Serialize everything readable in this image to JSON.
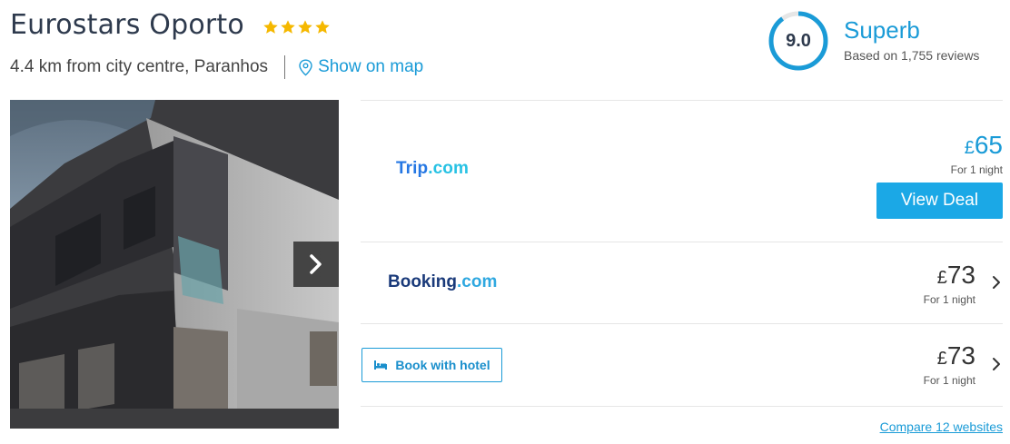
{
  "hotel": {
    "name": "Eurostars Oporto",
    "star_rating": 4,
    "distance_text": "4.4 km from city centre, Paranhos",
    "map_link_label": "Show on map",
    "map_icon": "location-pin-icon"
  },
  "rating": {
    "score": "9.0",
    "score_fraction": 0.9,
    "label": "Superb",
    "reviews_text": "Based on 1,755 reviews"
  },
  "gallery": {
    "next_icon": "chevron-right-icon"
  },
  "deals": [
    {
      "provider": "Trip.com",
      "logo_main": "Trip",
      "logo_suffix": ".com",
      "currency": "£",
      "price": "65",
      "per_night": "For 1 night",
      "cta_label": "View Deal"
    },
    {
      "provider": "Booking.com",
      "logo_main": "Booking",
      "logo_suffix": ".com",
      "currency": "£",
      "price": "73",
      "per_night": "For 1 night",
      "expand_icon": "chevron-right-icon"
    },
    {
      "provider": "Book with hotel",
      "button_label": "Book with hotel",
      "button_icon": "bed-icon",
      "currency": "£",
      "price": "73",
      "per_night": "For 1 night",
      "expand_icon": "chevron-right-icon"
    }
  ],
  "compare_link": "Compare 12 websites",
  "colors": {
    "accent": "#1a9bd7",
    "cta": "#1ba8e6",
    "star": "#f5b800",
    "title": "#2e3a4d"
  }
}
